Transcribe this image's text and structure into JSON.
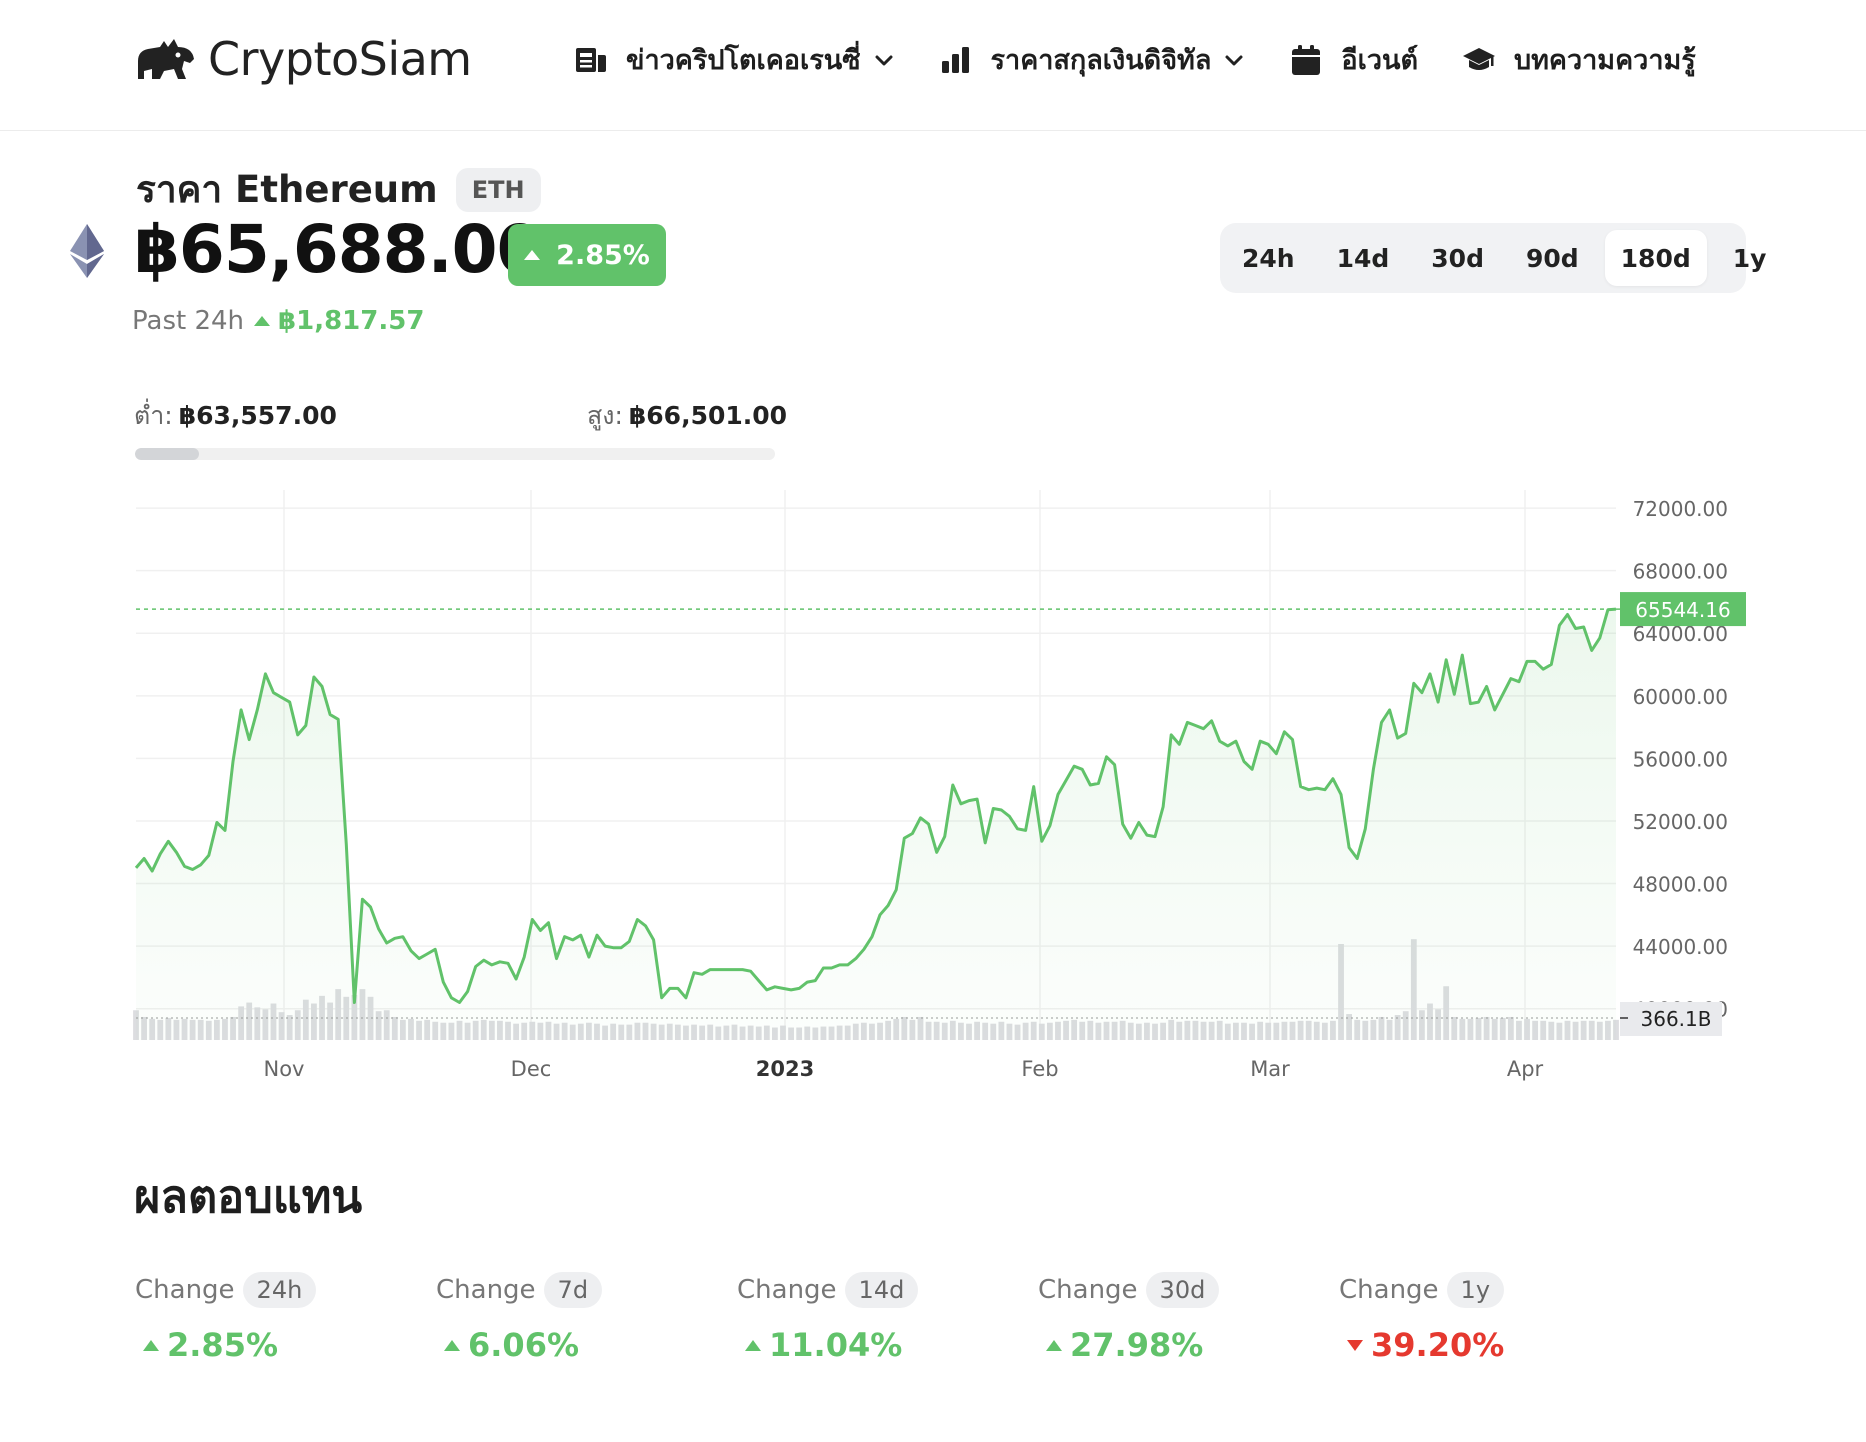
{
  "header": {
    "logo_text": "CryptoSiam",
    "nav": [
      {
        "label": "ข่าวคริปโตเคอเรนซี่",
        "icon": "news-icon",
        "dropdown": true
      },
      {
        "label": "ราคาสกุลเงินดิจิทัล",
        "icon": "bar-chart-icon",
        "dropdown": true
      },
      {
        "label": "อีเวนต์",
        "icon": "calendar-icon",
        "dropdown": false
      },
      {
        "label": "บทความความรู้",
        "icon": "graduation-cap-icon",
        "dropdown": false
      }
    ]
  },
  "coin": {
    "title": "ราคา Ethereum",
    "ticker": "ETH",
    "price": "฿65,688.00",
    "change_pct": "2.85%",
    "past_label": "Past 24h",
    "past_change": "฿1,817.57",
    "low_label": "ต่ำ:",
    "low_value": "฿63,557.00",
    "high_label": "สูง:",
    "high_value": "฿66,501.00",
    "range_position": 0.1
  },
  "ranges": {
    "options": [
      "24h",
      "14d",
      "30d",
      "90d",
      "180d",
      "1y"
    ],
    "selected": "180d"
  },
  "colors": {
    "up": "#61c26a",
    "down": "#e5392f",
    "volume": "#dcdde0"
  },
  "chart_data": {
    "type": "area",
    "x_ticks": [
      "Nov",
      "Dec",
      "2023",
      "Feb",
      "Mar",
      "Apr"
    ],
    "y_ticks": [
      "72000.00",
      "68000.00",
      "64000.00",
      "60000.00",
      "56000.00",
      "52000.00",
      "48000.00",
      "44000.00",
      "40000.00"
    ],
    "ylim": [
      38000,
      72900
    ],
    "current_label": "65544.16",
    "current_value": 65544.16,
    "volume_label": "366.1B",
    "grid": true,
    "price": [
      49000,
      49600,
      48800,
      49900,
      50700,
      50000,
      49100,
      48900,
      49200,
      49800,
      51900,
      51400,
      55800,
      59100,
      57200,
      59100,
      61400,
      60200,
      59900,
      59600,
      57500,
      58100,
      61200,
      60600,
      58800,
      58500,
      50500,
      40400,
      47000,
      46500,
      45100,
      44200,
      44500,
      44600,
      43700,
      43200,
      43500,
      43800,
      41700,
      40700,
      40400,
      41100,
      42700,
      43100,
      42800,
      43000,
      42900,
      41900,
      43300,
      45700,
      45000,
      45500,
      43200,
      44600,
      44400,
      44700,
      43300,
      44700,
      44000,
      43900,
      43900,
      44300,
      45700,
      45300,
      44400,
      40700,
      41300,
      41300,
      40700,
      42300,
      42200,
      42500,
      42500,
      42500,
      42500,
      42500,
      42400,
      41800,
      41200,
      41400,
      41300,
      41200,
      41300,
      41700,
      41800,
      42600,
      42600,
      42800,
      42800,
      43200,
      43800,
      44600,
      46000,
      46600,
      47600,
      50900,
      51200,
      52200,
      51800,
      50000,
      51000,
      54300,
      53100,
      53300,
      53400,
      50600,
      52800,
      52700,
      52300,
      51500,
      51400,
      54200,
      50700,
      51700,
      53700,
      54600,
      55500,
      55300,
      54300,
      54400,
      56100,
      55600,
      51800,
      50900,
      51900,
      51100,
      51000,
      52900,
      57500,
      56900,
      58300,
      58100,
      57900,
      58400,
      57100,
      56800,
      57100,
      55800,
      55300,
      57100,
      56900,
      56300,
      57700,
      57200,
      54200,
      54000,
      54100,
      54000,
      54700,
      53700,
      50300,
      49600,
      51500,
      55300,
      58300,
      59100,
      57300,
      57600,
      60800,
      60200,
      61400,
      59600,
      62300,
      60100,
      62600,
      59500,
      59600,
      60600,
      59100,
      60100,
      61100,
      60900,
      62200,
      62200,
      61700,
      62000,
      64500,
      65200,
      64300,
      64400,
      62900,
      63700,
      65500,
      65544
    ],
    "volume": [
      0.31,
      0.24,
      0.22,
      0.21,
      0.23,
      0.21,
      0.22,
      0.21,
      0.21,
      0.2,
      0.21,
      0.22,
      0.24,
      0.35,
      0.39,
      0.34,
      0.32,
      0.38,
      0.29,
      0.26,
      0.31,
      0.42,
      0.38,
      0.46,
      0.39,
      0.53,
      0.45,
      0.47,
      0.53,
      0.45,
      0.3,
      0.31,
      0.24,
      0.21,
      0.22,
      0.2,
      0.21,
      0.19,
      0.18,
      0.18,
      0.2,
      0.18,
      0.2,
      0.21,
      0.2,
      0.2,
      0.19,
      0.17,
      0.18,
      0.19,
      0.18,
      0.19,
      0.17,
      0.18,
      0.16,
      0.17,
      0.18,
      0.17,
      0.15,
      0.17,
      0.16,
      0.16,
      0.18,
      0.18,
      0.17,
      0.16,
      0.17,
      0.16,
      0.15,
      0.16,
      0.15,
      0.16,
      0.14,
      0.15,
      0.16,
      0.14,
      0.15,
      0.14,
      0.15,
      0.13,
      0.15,
      0.13,
      0.13,
      0.14,
      0.13,
      0.14,
      0.14,
      0.15,
      0.15,
      0.17,
      0.18,
      0.17,
      0.18,
      0.2,
      0.22,
      0.24,
      0.21,
      0.24,
      0.19,
      0.19,
      0.18,
      0.2,
      0.18,
      0.17,
      0.19,
      0.18,
      0.17,
      0.19,
      0.17,
      0.16,
      0.18,
      0.19,
      0.17,
      0.18,
      0.19,
      0.2,
      0.21,
      0.19,
      0.2,
      0.18,
      0.19,
      0.19,
      0.2,
      0.18,
      0.17,
      0.18,
      0.17,
      0.18,
      0.21,
      0.19,
      0.2,
      0.2,
      0.19,
      0.19,
      0.2,
      0.17,
      0.18,
      0.18,
      0.17,
      0.19,
      0.18,
      0.18,
      0.19,
      0.19,
      0.2,
      0.2,
      0.19,
      0.18,
      0.2,
      1.0,
      0.27,
      0.21,
      0.2,
      0.21,
      0.24,
      0.21,
      0.26,
      0.3,
      1.05,
      0.31,
      0.38,
      0.32,
      0.56,
      0.24,
      0.22,
      0.22,
      0.23,
      0.24,
      0.22,
      0.23,
      0.24,
      0.2,
      0.22,
      0.2,
      0.2,
      0.19,
      0.18,
      0.2,
      0.19,
      0.2,
      0.2,
      0.19,
      0.2,
      0.21
    ]
  },
  "returns": {
    "title": "ผลตอบแทน",
    "change_label": "Change",
    "items": [
      {
        "period": "24h",
        "value": "2.85%",
        "direction": "up"
      },
      {
        "period": "7d",
        "value": "6.06%",
        "direction": "up"
      },
      {
        "period": "14d",
        "value": "11.04%",
        "direction": "up"
      },
      {
        "period": "30d",
        "value": "27.98%",
        "direction": "up"
      },
      {
        "period": "1y",
        "value": "39.20%",
        "direction": "down"
      }
    ]
  }
}
